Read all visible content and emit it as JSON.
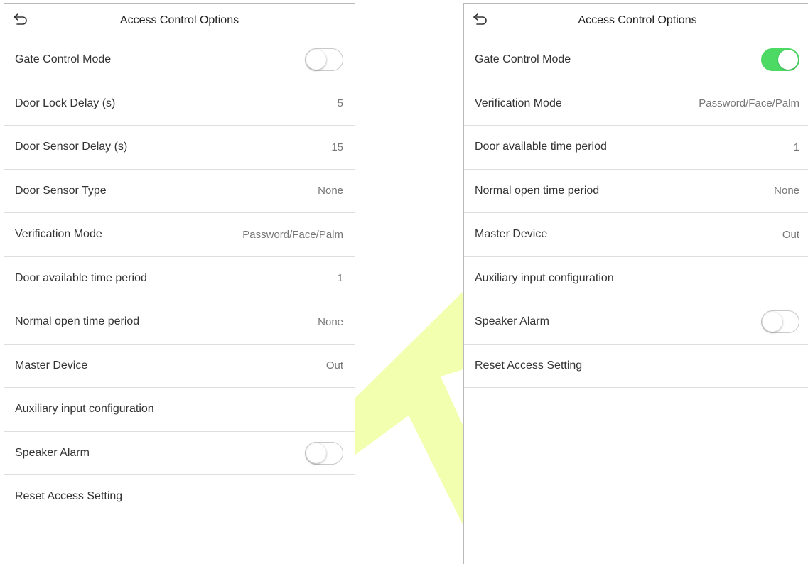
{
  "colors": {
    "toggle_on": "#4cd964",
    "watermark": "#e3ff00"
  },
  "left": {
    "title": "Access Control Options",
    "rows": [
      {
        "label": "Gate Control Mode",
        "toggle": "off"
      },
      {
        "label": "Door Lock Delay (s)",
        "value": "5"
      },
      {
        "label": "Door Sensor Delay (s)",
        "value": "15"
      },
      {
        "label": "Door Sensor Type",
        "value": "None"
      },
      {
        "label": "Verification Mode",
        "value": "Password/Face/Palm"
      },
      {
        "label": "Door available time period",
        "value": "1"
      },
      {
        "label": "Normal open time period",
        "value": "None"
      },
      {
        "label": "Master Device",
        "value": "Out"
      },
      {
        "label": "Auxiliary input configuration"
      },
      {
        "label": "Speaker Alarm",
        "toggle": "off"
      },
      {
        "label": "Reset Access Setting"
      }
    ]
  },
  "right": {
    "title": "Access Control Options",
    "rows": [
      {
        "label": "Gate Control Mode",
        "toggle": "on"
      },
      {
        "label": "Verification Mode",
        "value": "Password/Face/Palm"
      },
      {
        "label": "Door available time period",
        "value": "1"
      },
      {
        "label": "Normal open time period",
        "value": "None"
      },
      {
        "label": "Master Device",
        "value": "Out"
      },
      {
        "label": "Auxiliary input configuration"
      },
      {
        "label": "Speaker Alarm",
        "toggle": "off"
      },
      {
        "label": "Reset Access Setting"
      }
    ]
  }
}
